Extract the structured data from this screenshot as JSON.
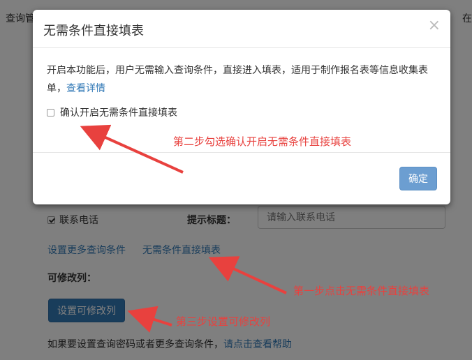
{
  "topbar": {
    "left_text": "查询管",
    "right_text": "在"
  },
  "form": {
    "phone_checkbox_label": "联系电话",
    "prompt_label": "提示标题：",
    "prompt_input_placeholder": "请输入联系电话",
    "link_more": "设置更多查询条件",
    "link_direct": "无需条件直接填表",
    "editable_label": "可修改列：",
    "editable_button": "设置可修改列",
    "help_prefix": "如果要设置查询密码或者更多查询条件，",
    "help_link": "请点击查看帮助"
  },
  "modal": {
    "title": "无需条件直接填表",
    "close": "×",
    "body_text": "开启本功能后，用户无需输入查询条件，直接进入填表，适用于制作报名表等信息收集表单，",
    "body_link": "查看详情",
    "confirm_label": "确认开启无需条件直接填表",
    "ok_button": "确定"
  },
  "annotations": {
    "step1": "第一步点击无需条件直接填表",
    "step2": "第二步勾选确认开启无需条件直接填表",
    "step3": "第三步设置可修改列"
  },
  "colors": {
    "annotation": "#e8413e",
    "primary": "#337ab7",
    "link": "#337ab7"
  }
}
